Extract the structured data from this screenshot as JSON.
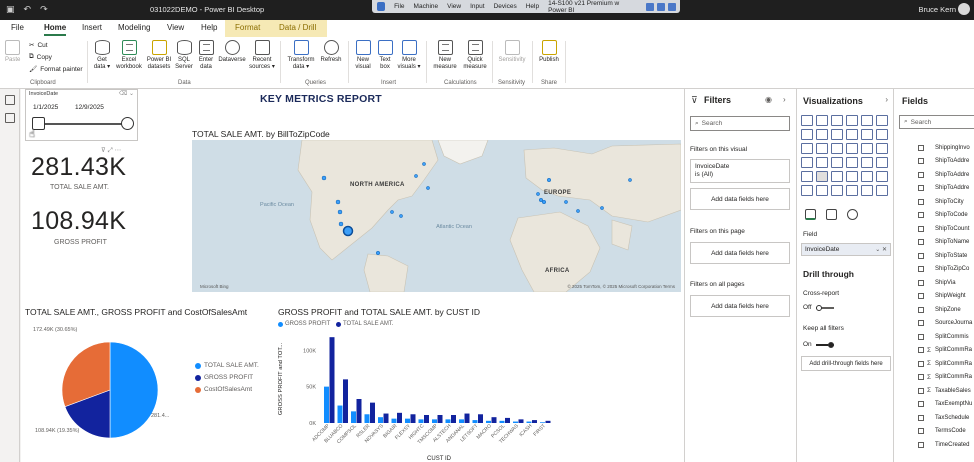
{
  "titlebar": {
    "doc_title": "031022DEMO - Power BI Desktop",
    "user_name": "Bruce Kern",
    "remote_menu": [
      "File",
      "Machine",
      "View",
      "Input",
      "Devices",
      "Help"
    ],
    "remote_title": "14-S100 v21 Premium w Power BI"
  },
  "menu": {
    "tabs": [
      "File",
      "Home",
      "Insert",
      "Modeling",
      "View",
      "Help",
      "Format",
      "Data / Drill"
    ],
    "active": "Home"
  },
  "ribbon": {
    "clipboard": {
      "paste": "Paste",
      "cut": "Cut",
      "copy": "Copy",
      "format_painter": "Format painter",
      "group": "Clipboard"
    },
    "data": {
      "get_data": "Get data ▾",
      "excel": "Excel workbook",
      "pbi_datasets": "Power BI datasets",
      "sql": "SQL Server",
      "enter_data": "Enter data",
      "dataverse": "Dataverse",
      "recent": "Recent sources ▾",
      "group": "Data"
    },
    "queries": {
      "transform": "Transform data ▾",
      "refresh": "Refresh",
      "group": "Queries"
    },
    "insert": {
      "new_visual": "New visual",
      "text_box": "Text box",
      "more_visuals": "More visuals ▾",
      "group": "Insert"
    },
    "calculations": {
      "new_measure": "New measure",
      "quick_measure": "Quick measure",
      "group": "Calculations"
    },
    "sensitivity": {
      "label": "Sensitivity",
      "group": "Sensitivity"
    },
    "share": {
      "publish": "Publish",
      "group": "Share"
    }
  },
  "canvas": {
    "report_title": "KEY METRICS REPORT",
    "slicer": {
      "title": "InvoiceDate",
      "start": "1/1/2025",
      "end": "12/9/2025"
    },
    "kpis": [
      {
        "value": "281.43K",
        "label": "TOTAL SALE AMT."
      },
      {
        "value": "108.94K",
        "label": "GROSS PROFIT"
      }
    ],
    "map": {
      "title": "TOTAL SALE AMT. by BillToZipCode",
      "labels": [
        "NORTH AMERICA",
        "EUROPE",
        "AFRICA"
      ],
      "oceans": [
        "Pacific Ocean",
        "Atlantic Ocean"
      ],
      "copyright": "© 2025 TomTom, © 2025 Microsoft Corporation  Terms",
      "logo": "Microsoft Bing"
    },
    "pie_title": "TOTAL SALE AMT., GROSS PROFIT and CostOfSalesAmt",
    "bar_title": "GROSS PROFIT and TOTAL SALE AMT. by CUST ID"
  },
  "chart_data": [
    {
      "type": "pie",
      "title": "TOTAL SALE AMT., GROSS PROFIT and CostOfSalesAmt",
      "categories": [
        "TOTAL SALE AMT.",
        "GROSS PROFIT",
        "CostOfSalesAmt"
      ],
      "values": [
        281.43,
        108.94,
        172.49
      ],
      "data_labels": [
        "281.4...",
        "108.94K (19.35%)",
        "172.49K (30.65%)"
      ],
      "colors": [
        "#118dff",
        "#12239e",
        "#e66c37"
      ],
      "legend": "right"
    },
    {
      "type": "bar",
      "title": "GROSS PROFIT and TOTAL SALE AMT. by CUST ID",
      "xlabel": "CUST ID",
      "ylabel": "GROSS PROFIT and TOT...",
      "ylim": [
        0,
        110
      ],
      "yticks": [
        "0K",
        "50K",
        "100K"
      ],
      "legend": "top-left",
      "categories": [
        "ADCOMP",
        "BLUABCO",
        "COMPSOL",
        "RSLER",
        "NOVASYS",
        "BIGAIR",
        "FLEXSY",
        "HIGHTC",
        "TMSCOMP",
        "ALSTECH",
        "ANDANAL",
        "LETSOFT",
        "MACRO",
        "PCSOL",
        "TECHWAS",
        "ICASH",
        "FIRST"
      ],
      "series": [
        {
          "name": "GROSS PROFIT",
          "color": "#118dff",
          "values": [
            50,
            24,
            16,
            12,
            8,
            6,
            6,
            5,
            5,
            5,
            5,
            4,
            3,
            3,
            2,
            2,
            1
          ]
        },
        {
          "name": "TOTAL SALE AMT.",
          "color": "#12239e",
          "values": [
            118,
            60,
            33,
            28,
            13,
            14,
            12,
            11,
            11,
            11,
            13,
            12,
            8,
            7,
            5,
            4,
            3
          ]
        }
      ]
    }
  ],
  "filters": {
    "title": "Filters",
    "search_placeholder": "Search",
    "on_visual": "Filters on this visual",
    "card_field": "InvoiceDate",
    "card_value": "is (All)",
    "on_page": "Filters on this page",
    "on_all": "Filters on all pages",
    "add_fields": "Add data fields here"
  },
  "visualizations": {
    "title": "Visualizations",
    "field_label": "Field",
    "field_value": "InvoiceDate",
    "drill_title": "Drill through",
    "cross_report": "Cross-report",
    "cross_state": "Off",
    "keep_filters": "Keep all filters",
    "keep_state": "On",
    "drill_drop": "Add drill-through fields here"
  },
  "fields": {
    "title": "Fields",
    "search_placeholder": "Search",
    "items": [
      {
        "label": "ShippingInvo",
        "sigma": false
      },
      {
        "label": "ShipToAddre",
        "sigma": false
      },
      {
        "label": "ShipToAddre",
        "sigma": false
      },
      {
        "label": "ShipToAddre",
        "sigma": false
      },
      {
        "label": "ShipToCity",
        "sigma": false
      },
      {
        "label": "ShipToCode",
        "sigma": false
      },
      {
        "label": "ShipToCount",
        "sigma": false
      },
      {
        "label": "ShipToName",
        "sigma": false
      },
      {
        "label": "ShipToState",
        "sigma": false
      },
      {
        "label": "ShipToZipCo",
        "sigma": false
      },
      {
        "label": "ShipVia",
        "sigma": false
      },
      {
        "label": "ShipWeight",
        "sigma": false
      },
      {
        "label": "ShipZone",
        "sigma": false
      },
      {
        "label": "SourceJourna",
        "sigma": false
      },
      {
        "label": "SplitCommis",
        "sigma": false
      },
      {
        "label": "SplitCommRa",
        "sigma": true
      },
      {
        "label": "SplitCommRa",
        "sigma": true
      },
      {
        "label": "SplitCommRa",
        "sigma": true
      },
      {
        "label": "TaxableSales",
        "sigma": true
      },
      {
        "label": "TaxExemptNu",
        "sigma": false
      },
      {
        "label": "TaxSchedule",
        "sigma": false
      },
      {
        "label": "TermsCode",
        "sigma": false
      },
      {
        "label": "TimeCreated",
        "sigma": false
      }
    ]
  }
}
